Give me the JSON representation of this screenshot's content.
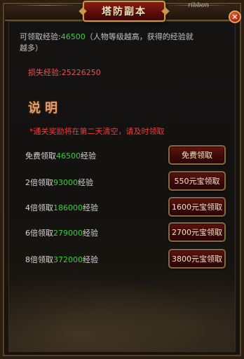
{
  "window": {
    "title": "塔防副本",
    "corner_text": "ribbon"
  },
  "info": {
    "exp_prefix": "可领取经验:",
    "exp_value": "46500",
    "exp_note_1": "（人物等级越高，获得的经验就",
    "exp_note_2": "越多）",
    "lost_prefix": "损失经验:",
    "lost_value": "25226250"
  },
  "description": {
    "title": "说明",
    "notice": "*通关奖励将在第二天清空，请及时领取"
  },
  "rewards": [
    {
      "prefix": "免费领取",
      "value": "46500",
      "suffix": "经验",
      "button": "免费领取"
    },
    {
      "prefix": "2倍领取",
      "value": "93000",
      "suffix": "经验",
      "button": "550元宝领取"
    },
    {
      "prefix": "4倍领取",
      "value": "186000",
      "suffix": "经验",
      "button": "1600元宝领取"
    },
    {
      "prefix": "6倍领取",
      "value": "279000",
      "suffix": "经验",
      "button": "2700元宝领取"
    },
    {
      "prefix": "8倍领取",
      "value": "372000",
      "suffix": "经验",
      "button": "3800元宝领取"
    }
  ],
  "colors": {
    "accent_green": "#3bd039",
    "warning_red": "#ee3c3c",
    "title_gold": "#f3e2b8"
  },
  "icons": {
    "close": "close-icon"
  }
}
